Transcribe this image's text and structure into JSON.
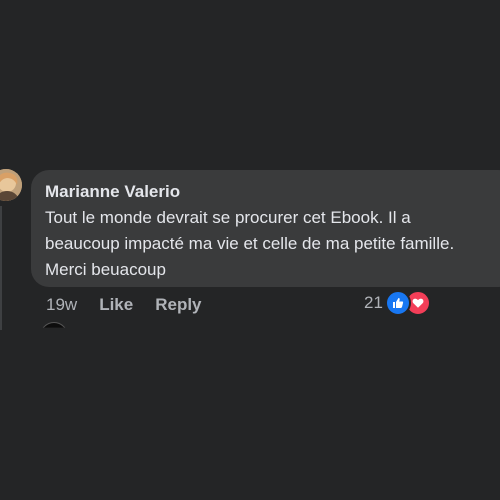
{
  "comment": {
    "author": "Marianne Valerio",
    "text": "Tout le monde devrait se procurer cet Ebook. Il a\nbeaucoup impacté ma vie et celle de ma petite famille.\nMerci beuacoup",
    "time": "19w",
    "like_label": "Like",
    "reply_label": "Reply",
    "reaction_count": "21",
    "reactions": [
      "like-icon",
      "love-icon"
    ]
  },
  "colors": {
    "background": "#242526",
    "bubble": "#3a3b3c",
    "text_primary": "#e4e6eb",
    "text_secondary": "#b0b3b8",
    "like_blue": "#1877f2",
    "love_red": "#f33e58"
  }
}
